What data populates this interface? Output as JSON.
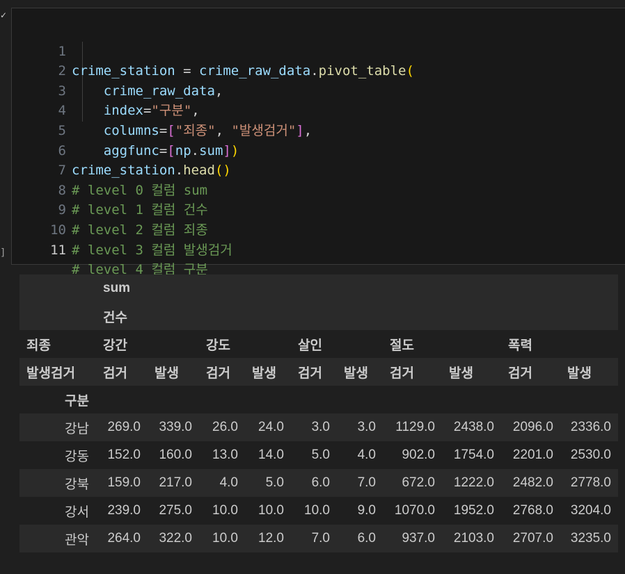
{
  "code_lines": [
    {
      "n": "1"
    },
    {
      "n": "2"
    },
    {
      "n": "3"
    },
    {
      "n": "4"
    },
    {
      "n": "5"
    },
    {
      "n": "6"
    },
    {
      "n": "7"
    },
    {
      "n": "8"
    },
    {
      "n": "9"
    },
    {
      "n": "10"
    },
    {
      "n": "11"
    }
  ],
  "code": {
    "var_station": "crime_station",
    "eq": " = ",
    "var_raw": "crime_raw_data",
    "dot": ".",
    "fn_pivot": "pivot_table",
    "open_paren": "(",
    "arg_raw": "crime_raw_data",
    "comma": ",",
    "kw_index": "index",
    "eqs": "=",
    "str_gubun": "\"구분\"",
    "kw_columns": "columns",
    "open_br": "[",
    "str_joejong": "\"죄종\"",
    "comma_sp": ", ",
    "str_balsaeng": "\"발생검거\"",
    "close_br": "]",
    "kw_aggfunc": "aggfunc",
    "np": "np",
    "sum": "sum",
    "close_paren": ")",
    "fn_head": "head",
    "parens": "()",
    "comment7": "# level 0 컬럼 sum",
    "comment8": "# level 1 컬럼 건수",
    "comment9": "# level 2 컬럼 죄종",
    "comment10": "# level 3 컬럼 발생검거",
    "comment11": "# level 4 컬럼 구분"
  },
  "table": {
    "level0": "sum",
    "level1": "건수",
    "level2_name": "죄종",
    "crimes": [
      "강간",
      "강도",
      "살인",
      "절도",
      "폭력"
    ],
    "level3_name": "발생검거",
    "subcols": [
      "검거",
      "발생",
      "검거",
      "발생",
      "검거",
      "발생",
      "검거",
      "발생",
      "검거",
      "발생"
    ],
    "index_name": "구분",
    "rows": [
      {
        "label": "강남",
        "values": [
          "269.0",
          "339.0",
          "26.0",
          "24.0",
          "3.0",
          "3.0",
          "1129.0",
          "2438.0",
          "2096.0",
          "2336.0"
        ]
      },
      {
        "label": "강동",
        "values": [
          "152.0",
          "160.0",
          "13.0",
          "14.0",
          "5.0",
          "4.0",
          "902.0",
          "1754.0",
          "2201.0",
          "2530.0"
        ]
      },
      {
        "label": "강북",
        "values": [
          "159.0",
          "217.0",
          "4.0",
          "5.0",
          "6.0",
          "7.0",
          "672.0",
          "1222.0",
          "2482.0",
          "2778.0"
        ]
      },
      {
        "label": "강서",
        "values": [
          "239.0",
          "275.0",
          "10.0",
          "10.0",
          "10.0",
          "9.0",
          "1070.0",
          "1952.0",
          "2768.0",
          "3204.0"
        ]
      },
      {
        "label": "관악",
        "values": [
          "264.0",
          "322.0",
          "10.0",
          "12.0",
          "7.0",
          "6.0",
          "937.0",
          "2103.0",
          "2707.0",
          "3235.0"
        ]
      }
    ]
  },
  "gutter": {
    "check": "✓",
    "bracket": "]"
  }
}
